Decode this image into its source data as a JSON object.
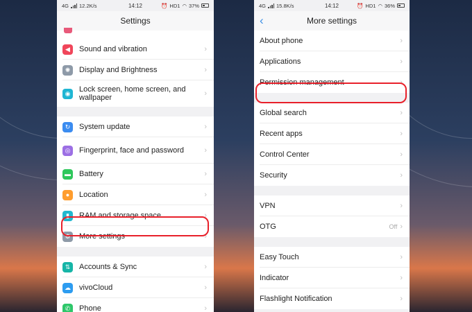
{
  "left_screen": {
    "status": {
      "network": "4G",
      "speed": "12.2K/s",
      "time": "14:12",
      "hd": "HD1",
      "battery": "37%"
    },
    "title": "Settings",
    "groups": [
      [
        {
          "label": "Sound and vibration",
          "icon": "speaker-icon",
          "color": "#f0465a"
        },
        {
          "label": "Display and Brightness",
          "icon": "brightness-icon",
          "color": "#8e9aa8"
        },
        {
          "label": "Lock screen, home screen, and wallpaper",
          "icon": "palette-icon",
          "color": "#1fb6d3"
        }
      ],
      [
        {
          "label": "System update",
          "icon": "update-icon",
          "color": "#3b8cf0"
        },
        {
          "label": "Fingerprint, face and password",
          "icon": "fingerprint-icon",
          "color": "#9c6fe4"
        },
        {
          "label": "Battery",
          "icon": "battery-icon",
          "color": "#2fc75c"
        },
        {
          "label": "Location",
          "icon": "location-icon",
          "color": "#ff9d2e"
        },
        {
          "label": "RAM and storage space",
          "icon": "storage-icon",
          "color": "#21b8cf"
        },
        {
          "label": "More settings",
          "icon": "more-settings-icon",
          "color": "#8e9aa8"
        }
      ],
      [
        {
          "label": "Accounts & Sync",
          "icon": "sync-icon",
          "color": "#16b5a7"
        },
        {
          "label": "vivoCloud",
          "icon": "cloud-icon",
          "color": "#2d9cf0"
        },
        {
          "label": "Phone",
          "icon": "phone-icon",
          "color": "#2ec76a"
        }
      ]
    ]
  },
  "right_screen": {
    "status": {
      "network": "4G",
      "speed": "15.8K/s",
      "time": "14:12",
      "hd": "HD1",
      "battery": "36%"
    },
    "title": "More settings",
    "back_icon": "back-icon",
    "groups": [
      [
        {
          "label": "About phone"
        },
        {
          "label": "Applications"
        },
        {
          "label": "Permission management"
        }
      ],
      [
        {
          "label": "Global search"
        },
        {
          "label": "Recent apps"
        },
        {
          "label": "Control Center"
        },
        {
          "label": "Security"
        }
      ],
      [
        {
          "label": "VPN"
        },
        {
          "label": "OTG",
          "value": "Off"
        }
      ],
      [
        {
          "label": "Easy Touch"
        },
        {
          "label": "Indicator"
        },
        {
          "label": "Flashlight Notification"
        }
      ]
    ]
  },
  "colors": {
    "highlight": "#e8202a",
    "accent": "#3a8ee6"
  }
}
